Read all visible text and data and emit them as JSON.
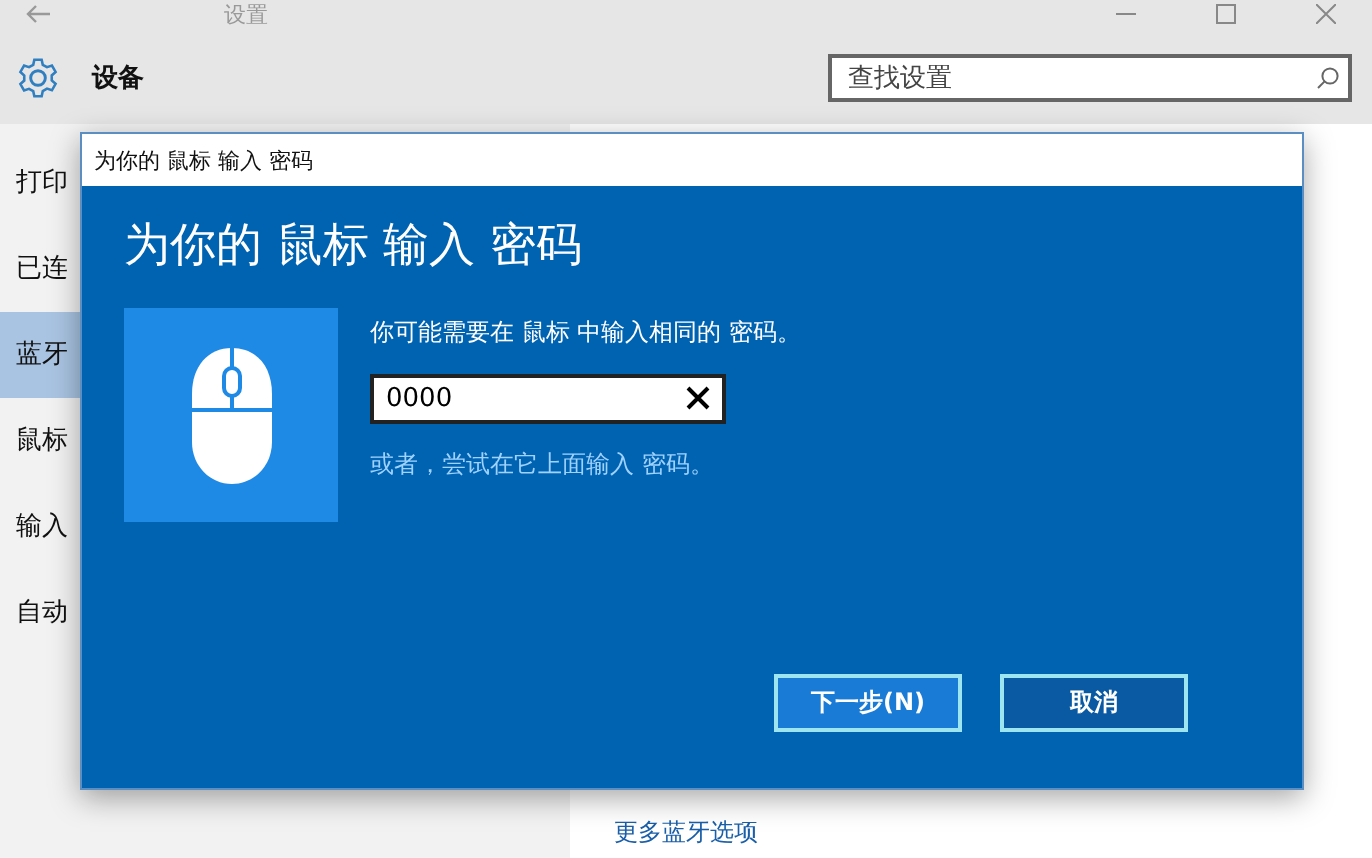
{
  "window": {
    "title": "设置"
  },
  "header": {
    "title": "设备",
    "search": {
      "placeholder": "查找设置"
    }
  },
  "sidebar": {
    "items": [
      {
        "label": "打印",
        "selected": false
      },
      {
        "label": "已连",
        "selected": false
      },
      {
        "label": "蓝牙",
        "selected": true
      },
      {
        "label": "鼠标",
        "selected": false
      },
      {
        "label": "输入",
        "selected": false
      },
      {
        "label": "自动",
        "selected": false
      }
    ]
  },
  "content": {
    "link": "更多蓝牙选项"
  },
  "dialog": {
    "title": "为你的 鼠标 输入 密码",
    "heading": "为你的 鼠标 输入 密码",
    "instruction": "你可能需要在 鼠标 中输入相同的 密码。",
    "pin": {
      "value": "0000"
    },
    "hint": "或者，尝试在它上面输入 密码。",
    "buttons": [
      {
        "label": "下一步(N)",
        "kind": "primary"
      },
      {
        "label": "取消",
        "kind": "secondary"
      }
    ]
  }
}
